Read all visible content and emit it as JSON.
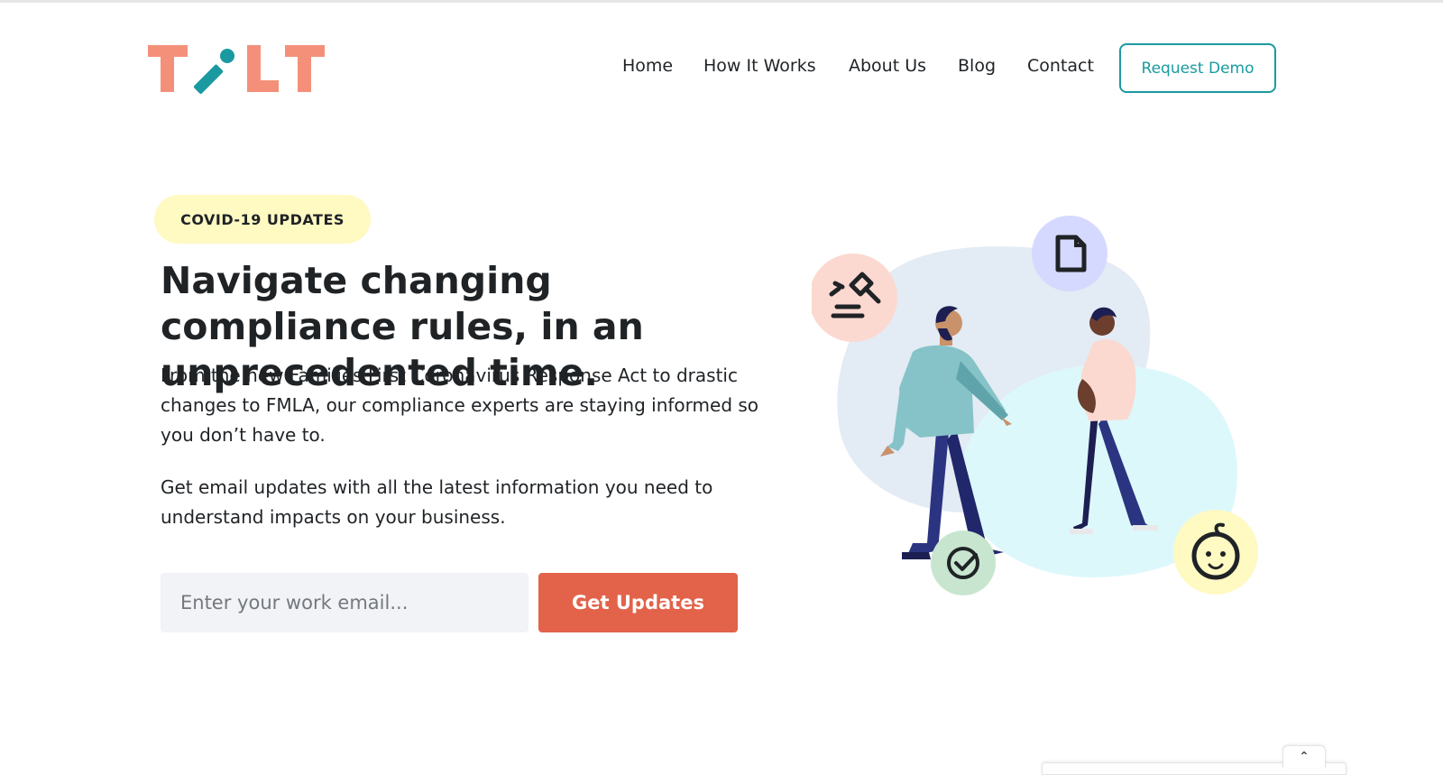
{
  "logo": {
    "text": "TILT",
    "color": "#f4907a",
    "accent_color": "#1a9aa0"
  },
  "nav": {
    "items": [
      "Home",
      "How It Works",
      "About Us",
      "Blog",
      "Contact"
    ],
    "cta_label": "Request Demo"
  },
  "hero": {
    "badge": "COVID-19 UPDATES",
    "headline": "Navigate changing compliance rules, in an unprecedented time.",
    "paragraph1": "From the new Families First Coronavirus Response Act to drastic changes to FMLA, our compliance experts are staying informed so you don’t have to.",
    "paragraph2": "Get email updates with all the latest information you need to understand impacts on your business.",
    "email_placeholder": "Enter your work email...",
    "email_value": "",
    "submit_label": "Get Updates"
  },
  "illustration": {
    "icons": [
      "gavel-icon",
      "document-icon",
      "checkmark-icon",
      "baby-face-icon"
    ]
  },
  "colors": {
    "brand_teal": "#1a9aa0",
    "cta_orange": "#e2634a",
    "badge_yellow": "#fff9c2",
    "input_bg": "#f1f3f7"
  },
  "widget": {
    "toggle_icon": "chevron-up-icon"
  }
}
